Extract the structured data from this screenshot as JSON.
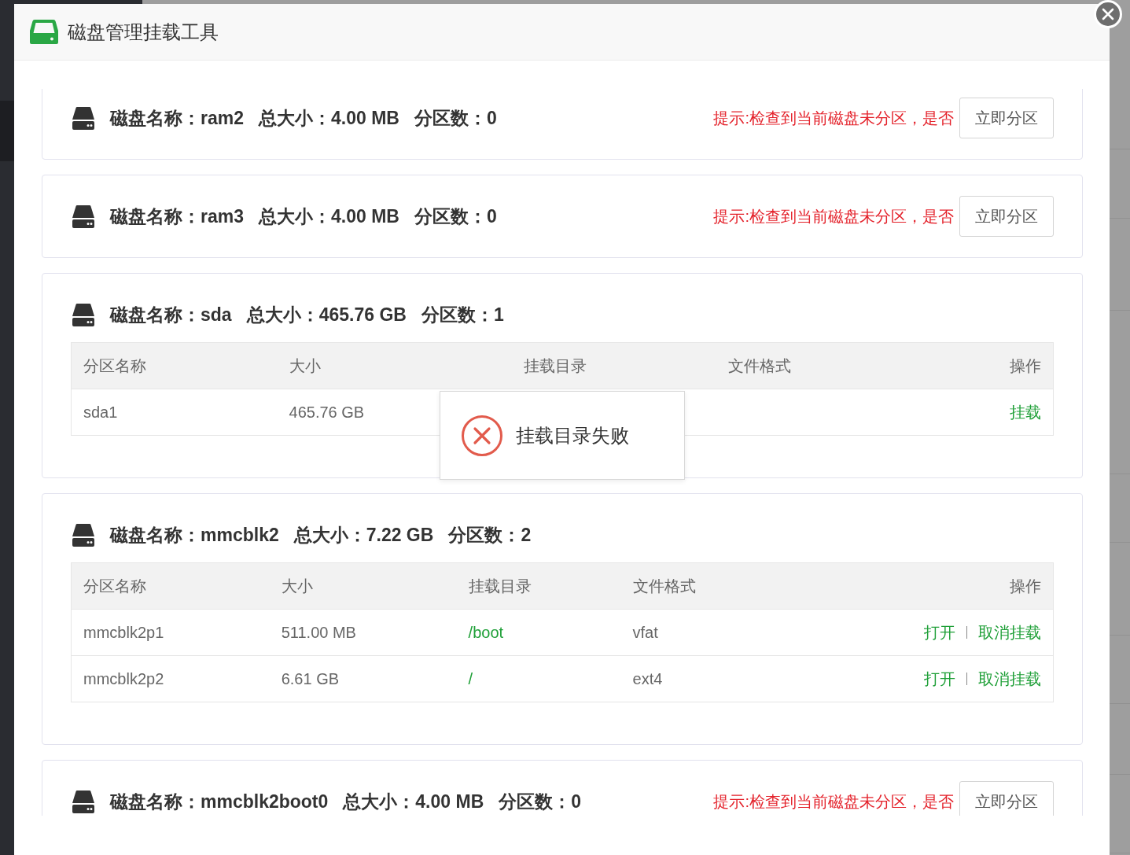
{
  "dialog": {
    "title": "磁盘管理挂载工具"
  },
  "disks": [
    {
      "kind": "unpartitioned",
      "name": "磁盘名称：ram2",
      "size": "总大小：4.00 MB",
      "partition_count": "分区数：0",
      "hint": "提示:检查到当前磁盘未分区，是否",
      "button": "立即分区"
    },
    {
      "kind": "unpartitioned",
      "name": "磁盘名称：ram3",
      "size": "总大小：4.00 MB",
      "partition_count": "分区数：0",
      "hint": "提示:检查到当前磁盘未分区，是否",
      "button": "立即分区"
    },
    {
      "kind": "partitioned",
      "name": "磁盘名称：sda",
      "size": "总大小：465.76 GB",
      "partition_count": "分区数：1",
      "table": {
        "columns": [
          "分区名称",
          "大小",
          "挂载目录",
          "文件格式",
          "操作"
        ],
        "rows": [
          {
            "partition": "sda1",
            "size": "465.76 GB",
            "actions": [
              "挂载"
            ]
          }
        ]
      }
    },
    {
      "kind": "partitioned",
      "name": "磁盘名称：mmcblk2",
      "size": "总大小：7.22 GB",
      "partition_count": "分区数：2",
      "table": {
        "columns": [
          "分区名称",
          "大小",
          "挂载目录",
          "文件格式",
          "操作"
        ],
        "rows": [
          {
            "partition": "mmcblk2p1",
            "size": "511.00 MB",
            "mount": "/boot",
            "format": "vfat",
            "actions": [
              "打开",
              "取消挂载"
            ]
          },
          {
            "partition": "mmcblk2p2",
            "size": "6.61 GB",
            "mount": "/",
            "format": "ext4",
            "actions": [
              "打开",
              "取消挂载"
            ]
          }
        ]
      }
    },
    {
      "kind": "unpartitioned",
      "name": "磁盘名称：mmcblk2boot0",
      "size": "总大小：4.00 MB",
      "partition_count": "分区数：0",
      "hint": "提示:检查到当前磁盘未分区，是否",
      "button": "立即分区"
    }
  ],
  "toast": {
    "kind": "error",
    "message": "挂载目录失败"
  }
}
